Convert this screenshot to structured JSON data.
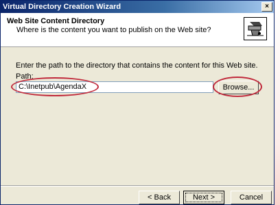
{
  "window": {
    "title": "Virtual Directory Creation Wizard",
    "close_label": "×"
  },
  "header": {
    "title": "Web Site Content Directory",
    "subtitle": "Where is the content you want to publish on the Web site?",
    "icon": "wizard-icon"
  },
  "main": {
    "instruction": "Enter the path to the directory that contains the content for this Web site.",
    "path_label": "Path:",
    "path_value": "C:\\Inetpub\\AgendaX",
    "browse_label": "Browse..."
  },
  "footer": {
    "back_label": "< Back",
    "next_label": "Next >",
    "cancel_label": "Cancel"
  },
  "colors": {
    "annotation": "#c0283a",
    "titlebar": "#0a246a",
    "dialog_bg": "#ece9d8"
  }
}
